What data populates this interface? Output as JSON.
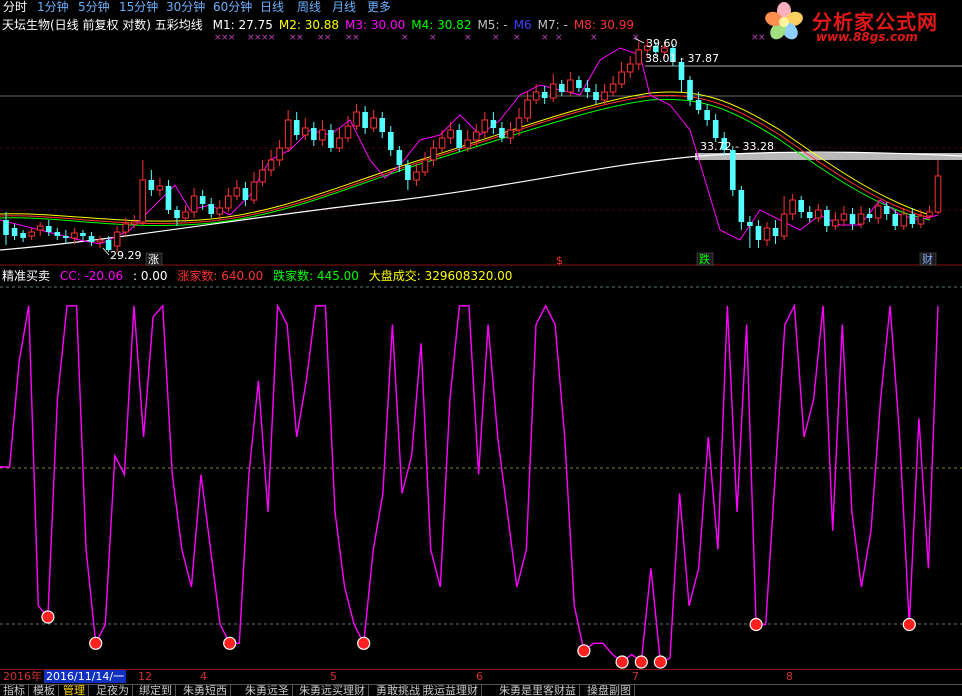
{
  "period_tabs": [
    {
      "label": "分时",
      "active": true
    },
    {
      "label": "1分钟"
    },
    {
      "label": "5分钟"
    },
    {
      "label": "15分钟"
    },
    {
      "label": "30分钟"
    },
    {
      "label": "60分钟"
    },
    {
      "label": "日线"
    },
    {
      "label": "周线"
    },
    {
      "label": "月线"
    },
    {
      "label": "更多"
    }
  ],
  "watermark": {
    "title": "分析家公式网",
    "url": "www.88gs.com"
  },
  "main_panel": {
    "indicator_title": "天坛生物(日线 前复权 对数) 五彩均线",
    "ma_readouts": [
      {
        "label": "M1: 27.75",
        "color": "#ffffff"
      },
      {
        "label": "M2: 30.88",
        "color": "#ffff00"
      },
      {
        "label": "M3: 30.00",
        "color": "#ff00ff"
      },
      {
        "label": "M4: 30.82",
        "color": "#00ff00"
      },
      {
        "label": "M5: -",
        "color": "#c0c0c0"
      },
      {
        "label": "M6",
        "color": "#4040ff"
      },
      {
        "label": "M7: -",
        "color": "#c0c0c0"
      },
      {
        "label": "M8: 30.99",
        "color": "#ff3030"
      }
    ],
    "price_labels": {
      "high": "39.60",
      "low": "29.29",
      "range_upper": "38.01 - 37.87",
      "range_lower": "33.72 - 33.28"
    },
    "signals": {
      "zhang": "涨",
      "dollar": "$",
      "die": "跌",
      "cai": "财"
    }
  },
  "osc_panel": {
    "name": "精准买卖",
    "cc": "CC: -20.06",
    "value": ": 0.00",
    "zhangjia": "涨家数: 640.00",
    "diejia": "跌家数: 445.00",
    "dapan": "大盘成交: 329608320.00"
  },
  "date_bar": {
    "year": "2016年",
    "current": "2016/11/14/一",
    "months": [
      {
        "label": "12"
      },
      {
        "label": "4"
      },
      {
        "label": "5"
      },
      {
        "label": "6"
      },
      {
        "label": "7"
      },
      {
        "label": "8"
      }
    ]
  },
  "bottom_tabs": [
    {
      "label": "指标"
    },
    {
      "label": "模板"
    },
    {
      "label": "管理",
      "active": true
    },
    {
      "label": "足夜为"
    },
    {
      "label": "绑定到"
    },
    {
      "label": "朱勇短西"
    },
    {
      "label": "朱勇远圣"
    },
    {
      "label": "朱勇远买理财"
    },
    {
      "label": "勇敢挑战"
    },
    {
      "label": "我运益理财"
    },
    {
      "label": "朱勇是里客财益"
    },
    {
      "label": "操盘副图"
    }
  ],
  "colors": {
    "background": "#000000",
    "bull_candle": "#ff3232",
    "bear_candle": "#54ffff",
    "oscillator": "#ff00ff",
    "signal_dot": "#ff2020",
    "grid_dashed": "#7aa0a0",
    "mid_dashed": "#b0b040"
  },
  "chart_data": {
    "type": "line",
    "series": [
      {
        "values": [
          52,
          52,
          80,
          95,
          15,
          12,
          70,
          95,
          95,
          30,
          5,
          10,
          55,
          50,
          95,
          60,
          92,
          95,
          50,
          30,
          20,
          50,
          30,
          10,
          5,
          5,
          50,
          75,
          40,
          95,
          90,
          60,
          75,
          95,
          95,
          40,
          20,
          10,
          5,
          30,
          45,
          90,
          45,
          55,
          85,
          30,
          20,
          70,
          95,
          95,
          50,
          90,
          60,
          40,
          20,
          30,
          90,
          95,
          90,
          60,
          15,
          3,
          5,
          5,
          2,
          0,
          2,
          0,
          25,
          0,
          1,
          45,
          15,
          25,
          60,
          30,
          95,
          40,
          90,
          10,
          10,
          50,
          90,
          95,
          60,
          70,
          95,
          35,
          90,
          40,
          20,
          35,
          70,
          95,
          60,
          10,
          65,
          25,
          95
        ]
      }
    ],
    "ylim": [
      0,
      100
    ]
  }
}
